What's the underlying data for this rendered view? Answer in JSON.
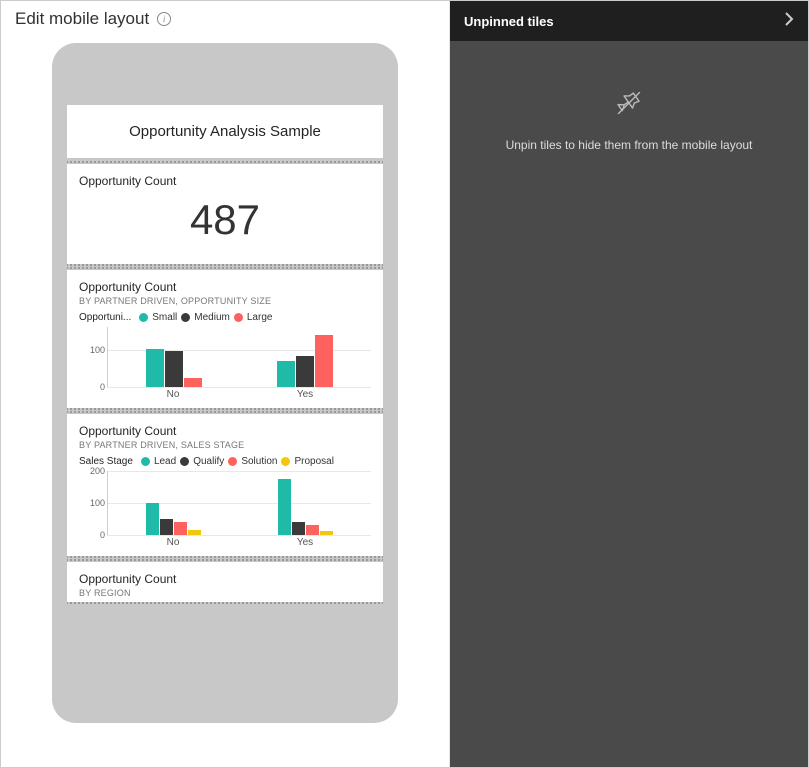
{
  "header": {
    "title": "Edit mobile layout"
  },
  "phone": {
    "dashboard_title": "Opportunity Analysis Sample"
  },
  "tile_count": {
    "title": "Opportunity Count",
    "value": "487"
  },
  "tile_partner_size": {
    "title": "Opportunity Count",
    "subtitle": "BY PARTNER DRIVEN, OPPORTUNITY SIZE",
    "legend_name": "Opportuni...",
    "legend": [
      "Small",
      "Medium",
      "Large"
    ]
  },
  "tile_partner_stage": {
    "title": "Opportunity Count",
    "subtitle": "BY PARTNER DRIVEN, SALES STAGE",
    "legend_name": "Sales Stage",
    "legend": [
      "Lead",
      "Qualify",
      "Solution",
      "Proposal"
    ]
  },
  "tile_region": {
    "title": "Opportunity Count",
    "subtitle": "BY REGION"
  },
  "right": {
    "title": "Unpinned tiles",
    "hint": "Unpin tiles to hide them from the mobile layout"
  },
  "colors": {
    "teal": "#1fbaa8",
    "dark": "#3a3a3a",
    "coral": "#fd625e",
    "yellow": "#f2c80f"
  },
  "chart_data": [
    {
      "type": "bar",
      "title": "Opportunity Count",
      "subtitle": "BY PARTNER DRIVEN, OPPORTUNITY SIZE",
      "categories": [
        "No",
        "Yes"
      ],
      "series": [
        {
          "name": "Small",
          "values": [
            102,
            70
          ]
        },
        {
          "name": "Medium",
          "values": [
            95,
            82
          ]
        },
        {
          "name": "Large",
          "values": [
            25,
            140
          ]
        }
      ],
      "xlabel": "",
      "ylabel": "",
      "yticks": [
        0,
        100
      ],
      "ylim": [
        0,
        160
      ]
    },
    {
      "type": "bar",
      "title": "Opportunity Count",
      "subtitle": "BY PARTNER DRIVEN, SALES STAGE",
      "categories": [
        "No",
        "Yes"
      ],
      "series": [
        {
          "name": "Lead",
          "values": [
            100,
            175
          ]
        },
        {
          "name": "Qualify",
          "values": [
            50,
            40
          ]
        },
        {
          "name": "Solution",
          "values": [
            40,
            30
          ]
        },
        {
          "name": "Proposal",
          "values": [
            15,
            12
          ]
        }
      ],
      "xlabel": "",
      "ylabel": "",
      "yticks": [
        0,
        100,
        200
      ],
      "ylim": [
        0,
        200
      ]
    }
  ]
}
